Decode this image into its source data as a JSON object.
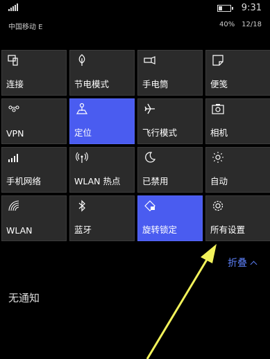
{
  "status_bar": {
    "time": "9:31",
    "carrier": "中国移动 E",
    "battery_percent": "40%",
    "date": "12/18",
    "battery_level": 0.4
  },
  "tiles": [
    {
      "label": "连接",
      "icon": "connect-icon",
      "active": false
    },
    {
      "label": "节电模式",
      "icon": "battery-saver-icon",
      "active": false
    },
    {
      "label": "手电筒",
      "icon": "flashlight-icon",
      "active": false
    },
    {
      "label": "便笺",
      "icon": "note-icon",
      "active": false
    },
    {
      "label": "VPN",
      "icon": "vpn-icon",
      "active": false
    },
    {
      "label": "定位",
      "icon": "location-icon",
      "active": true
    },
    {
      "label": "飞行模式",
      "icon": "airplane-icon",
      "active": false
    },
    {
      "label": "相机",
      "icon": "camera-icon",
      "active": false
    },
    {
      "label": "手机网络",
      "icon": "cellular-icon",
      "active": false
    },
    {
      "label": "WLAN 热点",
      "icon": "hotspot-icon",
      "active": false
    },
    {
      "label": "已禁用",
      "icon": "moon-icon",
      "active": false
    },
    {
      "label": "自动",
      "icon": "brightness-icon",
      "active": false
    },
    {
      "label": "WLAN",
      "icon": "wifi-icon",
      "active": false
    },
    {
      "label": "蓝牙",
      "icon": "bluetooth-icon",
      "active": false
    },
    {
      "label": "旋转锁定",
      "icon": "rotation-lock-icon",
      "active": true
    },
    {
      "label": "所有设置",
      "icon": "gear-icon",
      "active": false
    }
  ],
  "collapse_label": "折叠",
  "no_notifications": "无通知",
  "colors": {
    "accent": "#4a5cf0",
    "tile_bg": "#2b2b2b",
    "link": "#5b7ef4",
    "annotation_arrow": "#f2f25a"
  }
}
